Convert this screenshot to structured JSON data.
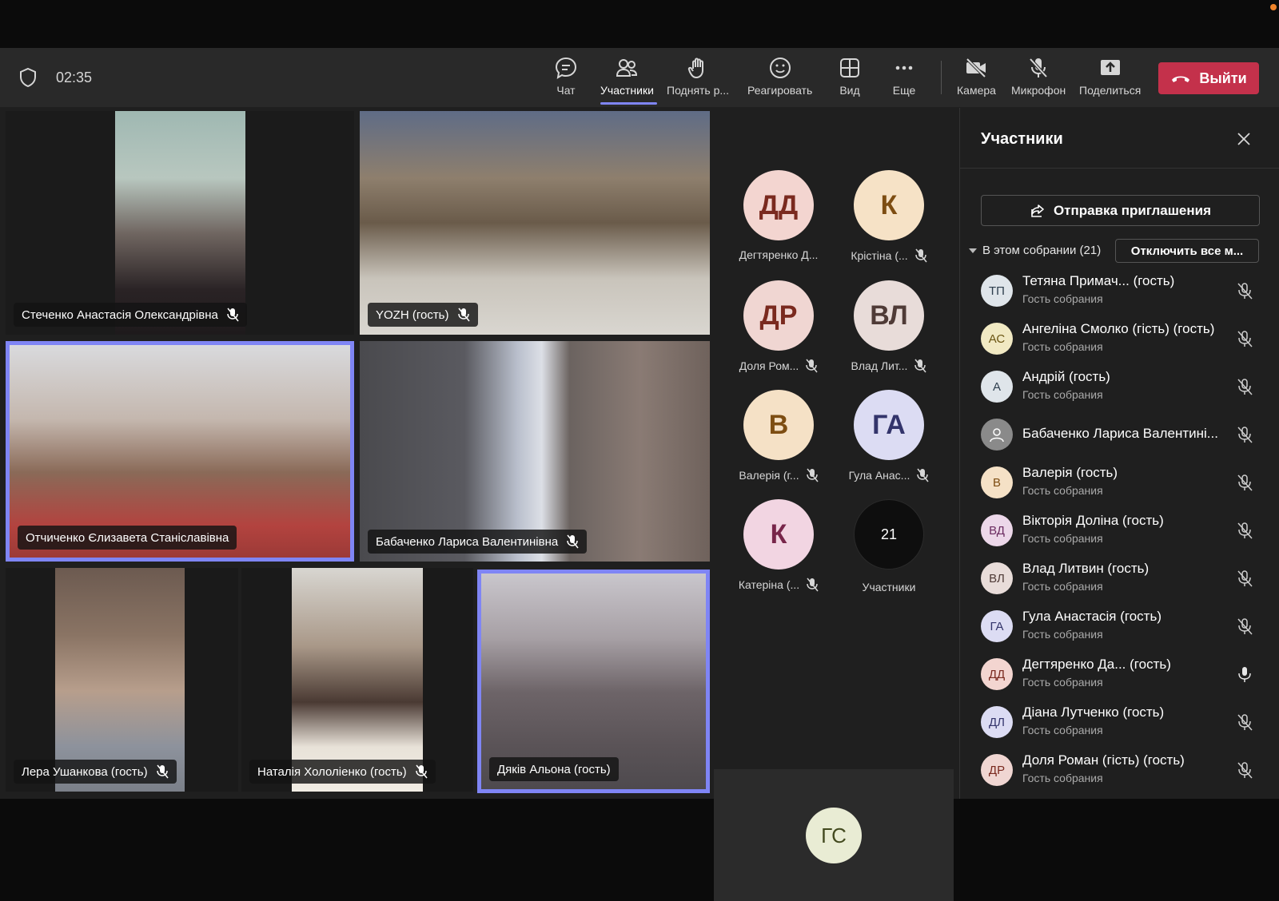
{
  "toolbar": {
    "timer": "02:35",
    "chat": "Чат",
    "participants": "Участники",
    "raise_hand": "Поднять р...",
    "react": "Реагировать",
    "view": "Вид",
    "more": "Еще",
    "camera": "Камера",
    "mic": "Микрофон",
    "share": "Поделиться",
    "leave": "Выйти"
  },
  "video_tiles": [
    {
      "name": "Стеченко Анастасія Олександрівна"
    },
    {
      "name": "YOZH (гость)"
    },
    {
      "name": "Отчиченко Єлизавета Станіславівна"
    },
    {
      "name": "Бабаченко Лариса Валентинівна"
    },
    {
      "name": "Лера Ушанкова (гость)"
    },
    {
      "name": "Наталія Хололіенко (гость)"
    },
    {
      "name": "Дяків Альона (гость)"
    }
  ],
  "avatar_grid": [
    {
      "initials": "ДД",
      "name": "Дегтяренко Д...",
      "bg": "#f3d5d0",
      "fg": "#7a2a1f",
      "muted": false
    },
    {
      "initials": "К",
      "name": "Крістіна (...",
      "bg": "#f6e2c6",
      "fg": "#7d4d12",
      "muted": true
    },
    {
      "initials": "ДР",
      "name": "Доля Ром...",
      "bg": "#f0d6d2",
      "fg": "#7a2a1f",
      "muted": true
    },
    {
      "initials": "ВЛ",
      "name": "Влад Лит...",
      "bg": "#e8dcd9",
      "fg": "#4f3b37",
      "muted": true
    },
    {
      "initials": "В",
      "name": "Валерія (г...",
      "bg": "#f5e1c6",
      "fg": "#7d4d12",
      "muted": true
    },
    {
      "initials": "ГА",
      "name": "Гула Анас...",
      "bg": "#dcdcf3",
      "fg": "#33346b",
      "muted": true
    },
    {
      "initials": "К",
      "name": "Катеріна (...",
      "bg": "#f2d5e2",
      "fg": "#78264a",
      "muted": true
    },
    {
      "initials": "21",
      "name": "Участники",
      "bg": "#0e0e0e",
      "fg": "#ffffff",
      "muted": false
    }
  ],
  "small_tile": {
    "initials": "ГС"
  },
  "panel": {
    "title": "Участники",
    "invite": "Отправка приглашения",
    "section": "В этом собрании (21)",
    "mute_all": "Отключить все м...",
    "participants": [
      {
        "initials": "ТП",
        "name": "Тетяна Примач... (гость)",
        "role": "Гость собрания",
        "bg": "#dfe5ea",
        "fg": "#2d3e4d",
        "muted": true
      },
      {
        "initials": "АС",
        "name": "Ангеліна Смолко (гість) (гость)",
        "role": "Гость собрания",
        "bg": "#f1e9c3",
        "fg": "#6b5512",
        "muted": true
      },
      {
        "initials": "А",
        "name": "Андрій (гость)",
        "role": "Гость собрания",
        "bg": "#dfe5ea",
        "fg": "#2d3e4d",
        "muted": true
      },
      {
        "initials": "",
        "name": "Бабаченко Лариса Валентині...",
        "role": "",
        "bg": "#8a8a8a",
        "fg": "#ffffff",
        "muted": true
      },
      {
        "initials": "В",
        "name": "Валерія (гость)",
        "role": "Гость собрания",
        "bg": "#f5e1c6",
        "fg": "#7d4d12",
        "muted": true
      },
      {
        "initials": "ВД",
        "name": "Вікторія Доліна (гость)",
        "role": "Гость собрания",
        "bg": "#ecd7e9",
        "fg": "#6b2c61",
        "muted": true
      },
      {
        "initials": "ВЛ",
        "name": "Влад Литвин (гость)",
        "role": "Гость собрания",
        "bg": "#e8dcd9",
        "fg": "#4f3b37",
        "muted": true
      },
      {
        "initials": "ГА",
        "name": "Гула Анастасія (гость)",
        "role": "Гость собрания",
        "bg": "#dcdcf3",
        "fg": "#33346b",
        "muted": true
      },
      {
        "initials": "ДД",
        "name": "Дегтяренко Да... (гость)",
        "role": "Гость собрания",
        "bg": "#f3d5d0",
        "fg": "#7a2a1f",
        "muted": false
      },
      {
        "initials": "ДЛ",
        "name": "Діана Лутченко (гость)",
        "role": "Гость собрания",
        "bg": "#dcdcf3",
        "fg": "#33346b",
        "muted": true
      },
      {
        "initials": "ДР",
        "name": "Доля Роман (гість) (гость)",
        "role": "Гость собрания",
        "bg": "#f0d6d2",
        "fg": "#7a2a1f",
        "muted": true
      }
    ]
  }
}
